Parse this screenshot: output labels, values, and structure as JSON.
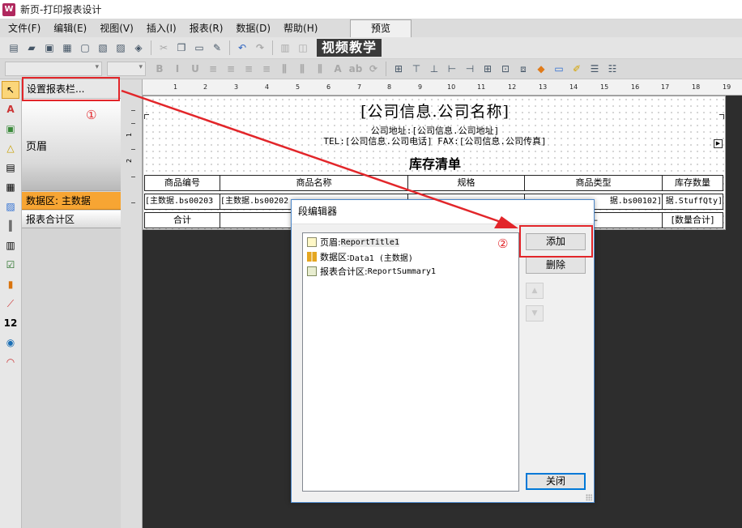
{
  "window": {
    "title": "新页-打印报表设计",
    "icon": "app-logo-icon"
  },
  "menu": [
    "文件(F)",
    "编辑(E)",
    "视图(V)",
    "插入(I)",
    "报表(R)",
    "数据(D)",
    "帮助(H)"
  ],
  "preview_tab": "预览",
  "toolbar": {
    "banner": "视频教学"
  },
  "band_panel": {
    "header_button": "设置报表栏...",
    "bands": {
      "page_header": "页眉",
      "data": "数据区: 主数据",
      "summary": "报表合计区"
    },
    "step1": "①"
  },
  "ruler": {
    "h_numbers": [
      "1",
      "2",
      "3",
      "4",
      "5",
      "6",
      "7",
      "8",
      "9",
      "10",
      "11",
      "12",
      "13",
      "14",
      "15",
      "16",
      "17",
      "18",
      "19"
    ],
    "v_numbers": [
      "1",
      "2"
    ]
  },
  "report": {
    "company_name": "[公司信息.公司名称]",
    "address": "公司地址:[公司信息.公司地址]",
    "contact": "TEL:[公司信息.公司电话]  FAX:[公司信息.公司传真]",
    "subtitle": "库存清单",
    "headers": [
      "商品编号",
      "商品名称",
      "规格",
      "商品类型",
      "库存数量"
    ],
    "data_row": [
      "[主数据.bs00203",
      "[主数据.bs00202",
      "",
      "据.bs00102]",
      "据.StuffQty]"
    ],
    "summary_row": [
      "合计",
      "—",
      "",
      "—",
      "[数量合计]"
    ]
  },
  "dialog": {
    "title": "段编辑器",
    "items": [
      {
        "icon": "page-header-band-icon",
        "label": "页眉: ",
        "mono": "ReportTitle1"
      },
      {
        "icon": "data-band-icon",
        "label": "数据区: ",
        "mono": "Data1 (主数据)"
      },
      {
        "icon": "summary-band-icon",
        "label": "报表合计区: ",
        "mono": "ReportSummary1"
      }
    ],
    "add_button": "添加",
    "delete_button": "删除",
    "close_button": "关闭",
    "step2": "②"
  },
  "colors": {
    "highlight": "#e2262a",
    "data_band": "#f7a533",
    "dialog_border": "#4a86c9"
  }
}
